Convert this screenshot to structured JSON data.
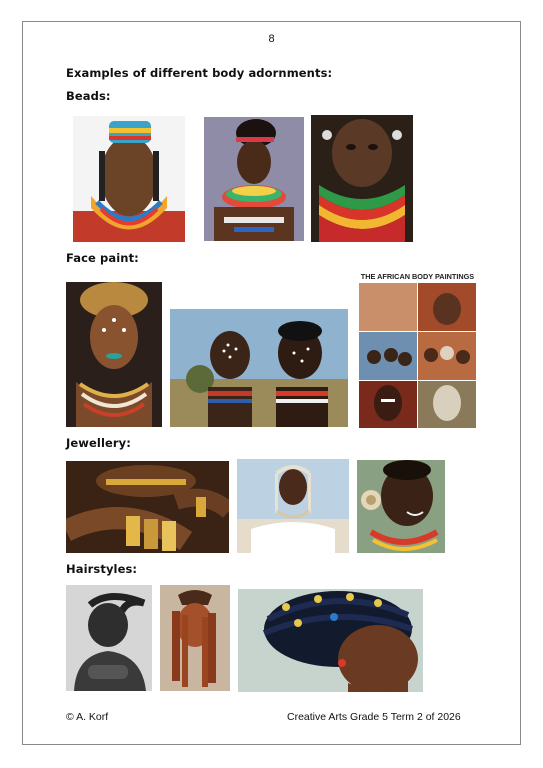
{
  "page": {
    "number": "8"
  },
  "headings": {
    "intro": "Examples of different body adornments:",
    "beads": "Beads:",
    "face_paint": "Face paint:",
    "jewellery": "Jewellery:",
    "hairstyles": "Hairstyles:"
  },
  "collage": {
    "title": "THE AFRICAN BODY PAINTINGS"
  },
  "footer": {
    "left": "© A. Korf",
    "right": "Creative Arts Grade 5 Term 2 of 2026"
  }
}
